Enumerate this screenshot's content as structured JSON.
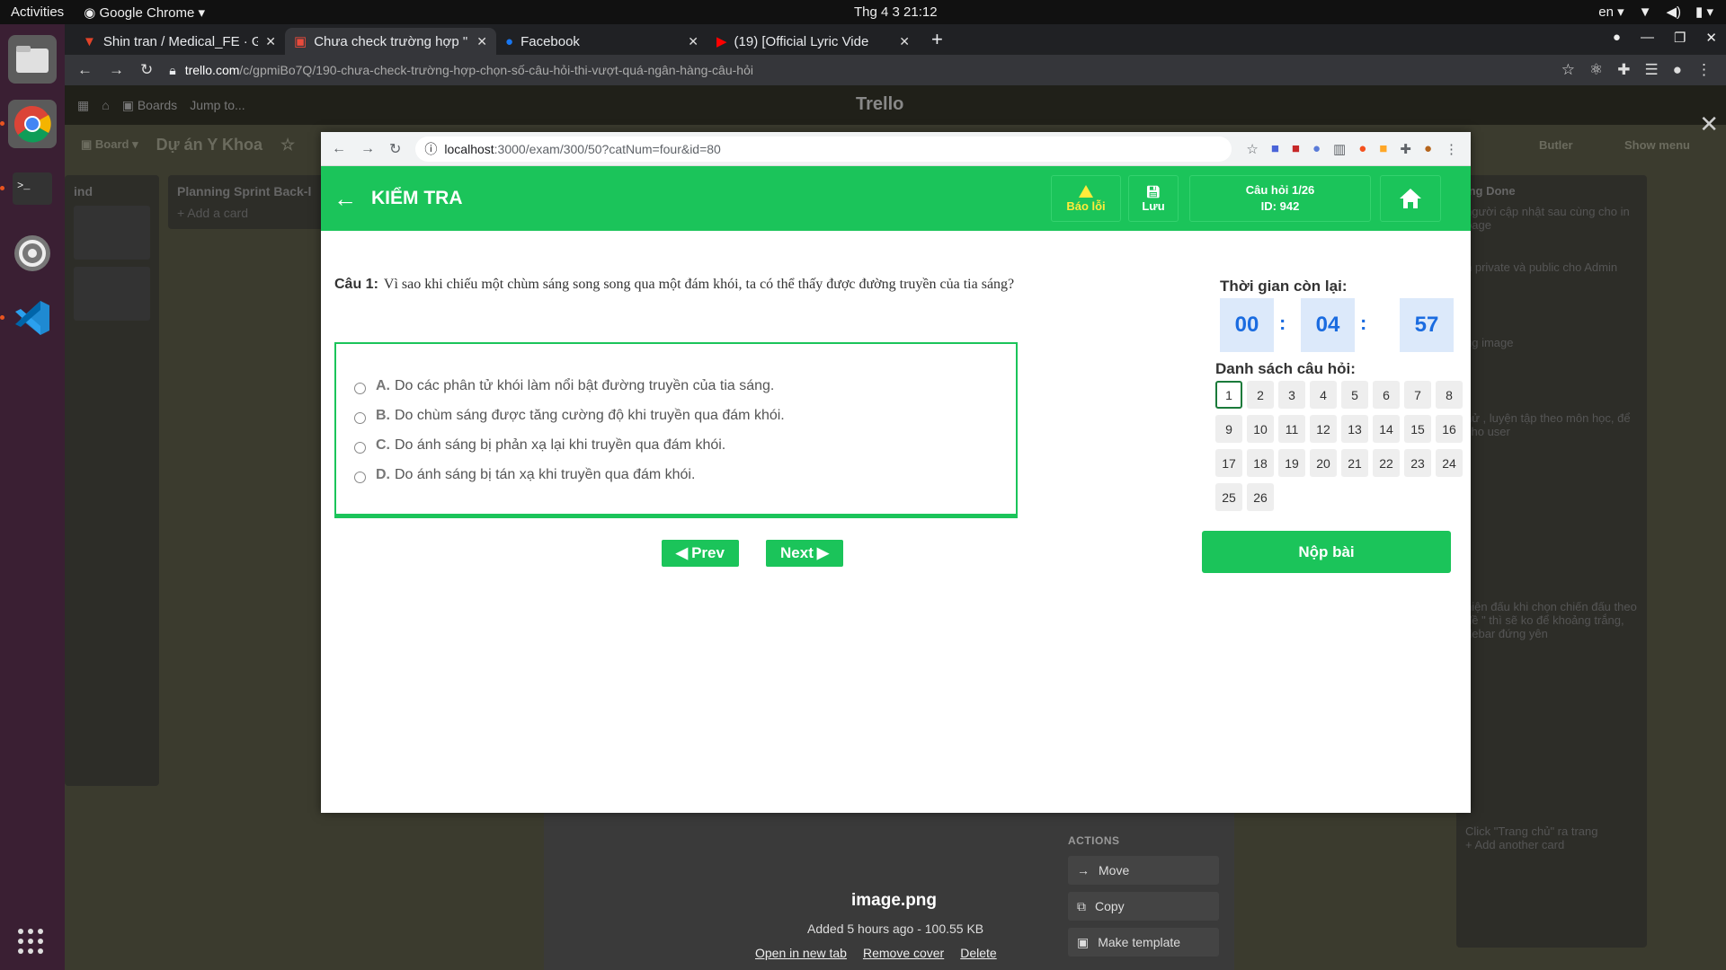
{
  "os": {
    "activities": "Activities",
    "app_menu": "Google Chrome",
    "clock": "Thg 4 3  21:12",
    "lang": "en"
  },
  "chrome": {
    "tabs": [
      {
        "title": "Shin tran / Medical_FE · G"
      },
      {
        "title": "Chưa check trường hợp \""
      },
      {
        "title": "Facebook"
      },
      {
        "title": "(19) [Official Lyric Vide"
      }
    ],
    "url_host": "trello.com",
    "url_path": "/c/gpmiBo7Q/190-chưa-check-trường-hợp-chọn-số-câu-hỏi-thi-vượt-quá-ngân-hàng-câu-hỏi"
  },
  "trello": {
    "board_name": "Dự án Y Khoa",
    "logo": "Trello",
    "boards_label": "Boards",
    "jump_label": "Jump to...",
    "board_btn": "Board",
    "butler": "Butler",
    "show_menu": "Show menu",
    "lists": [
      {
        "title": "ind"
      },
      {
        "title": "Planning Sprint Back-l",
        "add_card": "+ Add a card"
      },
      {
        "title": "ing Done"
      }
    ],
    "done_cards": [
      "người cập nhật sau cùng cho in page",
      "n private và public cho Admin",
      "ug image",
      "hử , luyện tập theo môn học, để cho user",
      "hiện đấu khi chọn chiến đấu theo đề \" thì sẽ ko để khoảng trắng, debar đứng yên",
      "Click \"Trang chủ\" ra trang"
    ],
    "add_another": "+ Add another card",
    "attachment": {
      "name": "image.png",
      "meta": "Added 5 hours ago - 100.55 KB",
      "open": "Open in new tab",
      "remove_cover": "Remove cover",
      "delete": "Delete"
    },
    "actions": {
      "title": "ACTIONS",
      "move": "Move",
      "copy": "Copy",
      "template": "Make template"
    }
  },
  "popup": {
    "url_host": "localhost",
    "url_path": ":3000/exam/300/50?catNum=four&id=80"
  },
  "exam": {
    "title": "KIỂM TRA",
    "report_label": "Báo lỗi",
    "save_label": "Lưu",
    "question_counter": "Câu hỏi 1/26",
    "question_id": "ID: 942",
    "question_label": "Câu 1:",
    "question_text": "Vì sao khi chiếu một chùm sáng song song qua một đám khói, ta có thể thấy được đường truyền của tia sáng?",
    "answers": [
      {
        "key": "A.",
        "text": "Do các phân tử khói làm nổi bật đường truyền của tia sáng."
      },
      {
        "key": "B.",
        "text": "Do chùm sáng được tăng cường độ khi truyền qua đám khói."
      },
      {
        "key": "C.",
        "text": "Do ánh sáng bị phản xạ lại khi truyền qua đám khói."
      },
      {
        "key": "D.",
        "text": "Do ánh sáng bị tán xạ khi truyền qua đám khói."
      }
    ],
    "prev_label": "Prev",
    "next_label": "Next",
    "timer_title": "Thời gian còn lại:",
    "timer": {
      "hours": "00",
      "minutes": "04",
      "seconds": "57"
    },
    "timer_sep": ":",
    "question_list_title": "Danh sách câu hỏi:",
    "question_numbers": [
      "1",
      "2",
      "3",
      "4",
      "5",
      "6",
      "7",
      "8",
      "9",
      "10",
      "11",
      "12",
      "13",
      "14",
      "15",
      "16",
      "17",
      "18",
      "19",
      "20",
      "21",
      "22",
      "23",
      "24",
      "25",
      "26"
    ],
    "current_question": "1",
    "submit_label": "Nộp bài"
  },
  "colors": {
    "accent_green": "#1bc45a",
    "timer_blue": "#1b6ce0",
    "warning_yellow": "#ffeb3b"
  }
}
